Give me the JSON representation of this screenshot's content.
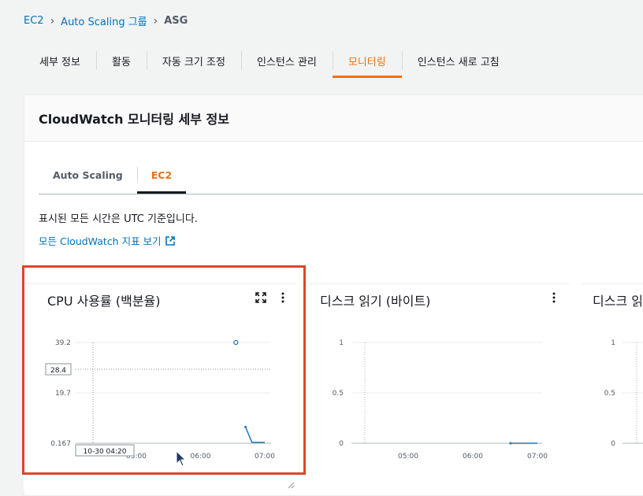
{
  "breadcrumb": {
    "items": [
      "EC2",
      "Auto Scaling 그룹",
      "ASG"
    ]
  },
  "tabs": [
    "세부 정보",
    "활동",
    "자동 크기 조정",
    "인스턴스 관리",
    "모니터링",
    "인스턴스 새로 고침"
  ],
  "active_tab": "모니터링",
  "panel": {
    "title": "CloudWatch 모니터링 세부 정보"
  },
  "subtabs": [
    "Auto Scaling",
    "EC2"
  ],
  "active_subtab": "EC2",
  "timezone_note": "표시된 모든 시간은 UTC 기준입니다.",
  "cloudwatch_link": "모든 CloudWatch 지표 보기",
  "colors": {
    "accent": "#ec7211",
    "link": "#0073bb",
    "highlight": "#e0442a",
    "series": "#1f77b4"
  },
  "chart_data": [
    {
      "type": "line",
      "title": "CPU 사용률 (백분율)",
      "y_ticks": [
        "39.2",
        "19.7",
        "0.167"
      ],
      "x_ticks": [
        "05:00",
        "06:00",
        "07:00"
      ],
      "ylim": [
        0.167,
        39.2
      ],
      "crosshair": {
        "y_label": "28.4",
        "x_label": "10-30 04:20"
      },
      "series": [
        {
          "x": [
            "06:33"
          ],
          "y": [
            39.2
          ],
          "marker": "hollow-point"
        },
        {
          "x": [
            "06:42",
            "06:48",
            "07:00"
          ],
          "y": [
            6.5,
            0.5,
            0.5
          ]
        }
      ]
    },
    {
      "type": "line",
      "title": "디스크 읽기 (바이트)",
      "y_ticks": [
        "1",
        "0.5",
        "0"
      ],
      "x_ticks": [
        "05:00",
        "06:00",
        "07:00"
      ],
      "ylim": [
        0,
        1
      ],
      "series": [
        {
          "x": [
            "06:35",
            "06:45",
            "07:00"
          ],
          "y": [
            0,
            0,
            0
          ]
        }
      ]
    },
    {
      "type": "line",
      "title": "디스크 읽",
      "y_ticks": [
        "1",
        "0.5",
        "0"
      ],
      "ylim": [
        0,
        1
      ],
      "series": []
    }
  ]
}
